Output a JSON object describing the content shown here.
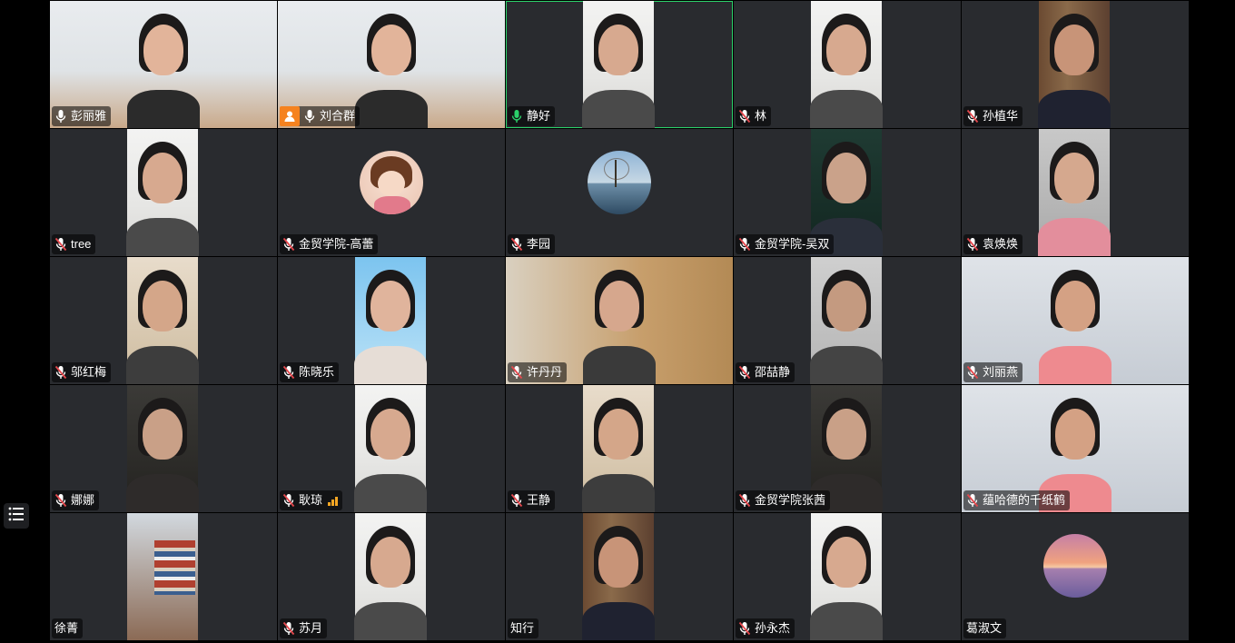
{
  "participants": [
    {
      "name": "彭丽雅",
      "mic": "on",
      "bg": "room-white"
    },
    {
      "name": "刘合群",
      "mic": "on",
      "bg": "room-white",
      "host": true
    },
    {
      "name": "静好",
      "mic": "on-active",
      "bg": "white-wall",
      "speaking": true
    },
    {
      "name": "林",
      "mic": "muted",
      "bg": "white-wall"
    },
    {
      "name": "孙植华",
      "mic": "muted",
      "bg": "bookshelf"
    },
    {
      "name": "tree",
      "mic": "muted",
      "bg": "white-wall"
    },
    {
      "name": "金贸学院-高蕾",
      "mic": "muted",
      "bg": "avatar-girl"
    },
    {
      "name": "李园",
      "mic": "muted",
      "bg": "avatar-lake"
    },
    {
      "name": "金贸学院-吴双",
      "mic": "muted",
      "bg": "green-dark"
    },
    {
      "name": "袁焕焕",
      "mic": "muted",
      "bg": "grey-room"
    },
    {
      "name": "邬红梅",
      "mic": "muted",
      "bg": "bookshelf-light"
    },
    {
      "name": "陈晓乐",
      "mic": "muted",
      "bg": "sky"
    },
    {
      "name": "许丹丹",
      "mic": "muted",
      "bg": "wood"
    },
    {
      "name": "邵喆静",
      "mic": "muted",
      "bg": "grey-wall"
    },
    {
      "name": "刘丽燕",
      "mic": "muted",
      "bg": "office"
    },
    {
      "name": "娜娜",
      "mic": "muted",
      "bg": "dark-room"
    },
    {
      "name": "耿琼",
      "mic": "muted",
      "bg": "white-wall",
      "signal": true
    },
    {
      "name": "王静",
      "mic": "muted",
      "bg": "bookshelf-light"
    },
    {
      "name": "金贸学院张茜",
      "mic": "muted",
      "bg": "dark-room"
    },
    {
      "name": "蕴哈德的千纸鹤",
      "mic": "muted",
      "bg": "office"
    },
    {
      "name": "徐菁",
      "mic": "none",
      "bg": "library"
    },
    {
      "name": "苏月",
      "mic": "muted",
      "bg": "white-wall"
    },
    {
      "name": "知行",
      "mic": "none",
      "bg": "bookshelf"
    },
    {
      "name": "孙永杰",
      "mic": "muted",
      "bg": "white-wall"
    },
    {
      "name": "葛淑文",
      "mic": "none",
      "bg": "avatar-sunset"
    }
  ],
  "icons": {
    "mic_on": "microphone-icon",
    "mic_muted": "microphone-muted-icon",
    "host": "host-person-icon",
    "list": "participant-list-icon",
    "signal": "signal-bars-icon"
  },
  "colors": {
    "tile_bg": "#292b2f",
    "speaking_border": "#2bd16a",
    "host_badge": "#f5821f",
    "muted_red": "#e5484d",
    "active_green": "#2bd16a"
  }
}
